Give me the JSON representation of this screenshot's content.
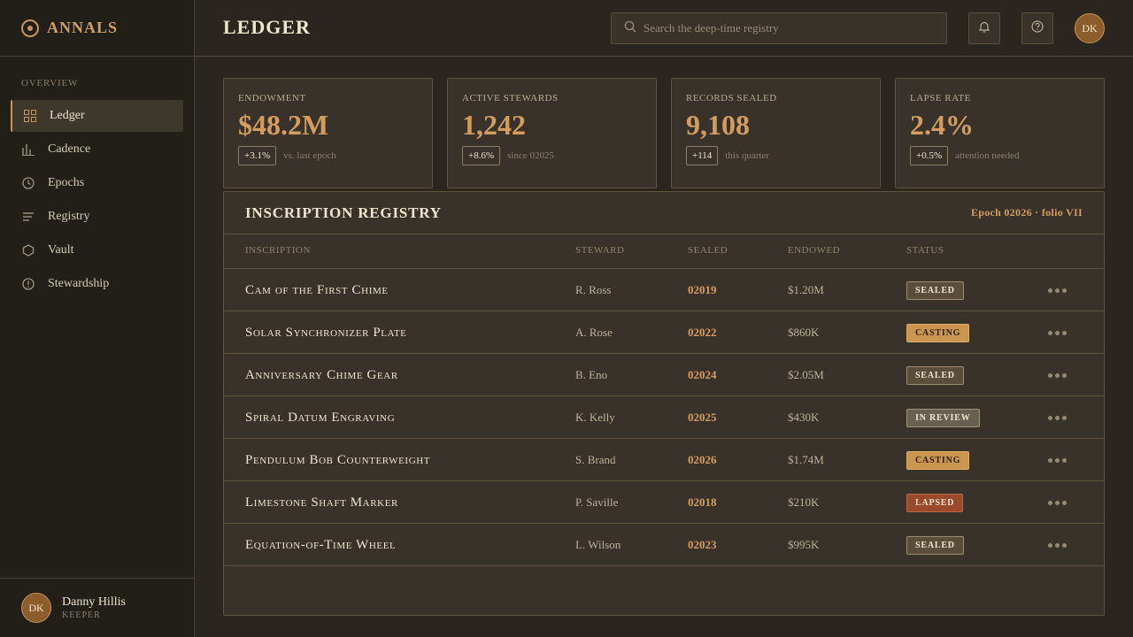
{
  "brand": {
    "name": "ANNALS",
    "icon": "sun-dial-icon"
  },
  "sidebar": {
    "section_label": "OVERVIEW",
    "items": [
      {
        "label": "Ledger",
        "icon": "grid-icon",
        "active": true
      },
      {
        "label": "Cadence",
        "icon": "bar-chart-icon",
        "active": false
      },
      {
        "label": "Epochs",
        "icon": "clock-icon",
        "active": false
      },
      {
        "label": "Registry",
        "icon": "list-icon",
        "active": false
      },
      {
        "label": "Vault",
        "icon": "hexagon-icon",
        "active": false
      },
      {
        "label": "Stewardship",
        "icon": "alert-circle-icon",
        "active": false
      }
    ],
    "user": {
      "initials": "DK",
      "name": "Danny Hillis",
      "role": "KEEPER"
    }
  },
  "header": {
    "title": "LEDGER",
    "search_placeholder": "Search the deep-time registry",
    "avatar_initials": "DK"
  },
  "stats": [
    {
      "label": "ENDOWMENT",
      "value": "$48.2M",
      "delta": "+3.1%",
      "note": "vs. last epoch"
    },
    {
      "label": "ACTIVE STEWARDS",
      "value": "1,242",
      "delta": "+8.6%",
      "note": "since 02025"
    },
    {
      "label": "RECORDS SEALED",
      "value": "9,108",
      "delta": "+114",
      "note": "this quarter"
    },
    {
      "label": "LAPSE RATE",
      "value": "2.4%",
      "delta": "+0.5%",
      "note": "attention needed"
    }
  ],
  "registry": {
    "title": "INSCRIPTION REGISTRY",
    "meta": "Epoch 02026 · folio VII",
    "columns": [
      "INSCRIPTION",
      "STEWARD",
      "SEALED",
      "ENDOWED",
      "STATUS"
    ],
    "rows": [
      {
        "name": "Cam of the First Chime",
        "steward": "R. Ross",
        "sealed": "02019",
        "endowed": "$1.20M",
        "status": "SEALED",
        "status_kind": "sealed"
      },
      {
        "name": "Solar Synchronizer Plate",
        "steward": "A. Rose",
        "sealed": "02022",
        "endowed": "$860K",
        "status": "CASTING",
        "status_kind": "casting"
      },
      {
        "name": "Anniversary Chime Gear",
        "steward": "B. Eno",
        "sealed": "02024",
        "endowed": "$2.05M",
        "status": "SEALED",
        "status_kind": "sealed"
      },
      {
        "name": "Spiral Datum Engraving",
        "steward": "K. Kelly",
        "sealed": "02025",
        "endowed": "$430K",
        "status": "IN REVIEW",
        "status_kind": "review"
      },
      {
        "name": "Pendulum Bob Counterweight",
        "steward": "S. Brand",
        "sealed": "02026",
        "endowed": "$1.74M",
        "status": "CASTING",
        "status_kind": "casting"
      },
      {
        "name": "Limestone Shaft Marker",
        "steward": "P. Saville",
        "sealed": "02018",
        "endowed": "$210K",
        "status": "LAPSED",
        "status_kind": "lapsed"
      },
      {
        "name": "Equation-of-Time Wheel",
        "steward": "L. Wilson",
        "sealed": "02023",
        "endowed": "$995K",
        "status": "SEALED",
        "status_kind": "sealed"
      }
    ]
  },
  "colors": {
    "accent": "#d49d5e",
    "background": "#2a261f",
    "panel": "#38322a",
    "lapsed": "#9a4a2a"
  }
}
